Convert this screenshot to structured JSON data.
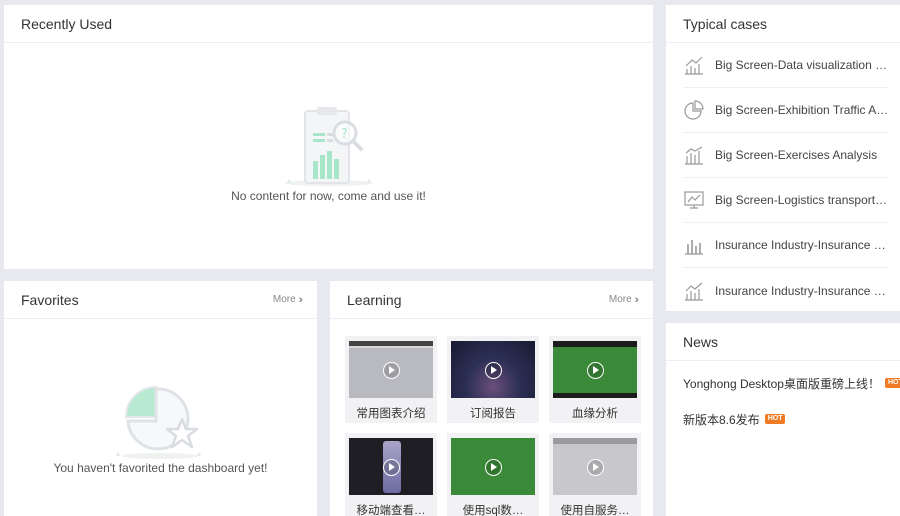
{
  "recent": {
    "title": "Recently Used",
    "empty_text": "No content for now, come and use it!"
  },
  "favorites": {
    "title": "Favorites",
    "more": "More",
    "empty_text": "You haven't favorited the dashboard yet!"
  },
  "learning": {
    "title": "Learning",
    "more": "More",
    "videos": [
      {
        "title": "常用图表介绍",
        "thumb": "gray"
      },
      {
        "title": "订阅报告",
        "thumb": "dark"
      },
      {
        "title": "血缘分析",
        "thumb": "green"
      },
      {
        "title": "移动端查看…",
        "thumb": "phone"
      },
      {
        "title": "使用sql数…",
        "thumb": "green"
      },
      {
        "title": "使用自服务…",
        "thumb": "light"
      }
    ]
  },
  "cases": {
    "title": "Typical cases",
    "items": [
      {
        "label": "Big Screen-Data visualization and analysis",
        "icon": "line-chart-icon"
      },
      {
        "label": "Big Screen-Exhibition Traffic Analysis",
        "icon": "pie-chart-icon"
      },
      {
        "label": "Big Screen-Exercises Analysis",
        "icon": "bar-line-chart-icon"
      },
      {
        "label": "Big Screen-Logistics transportation analysis",
        "icon": "monitor-chart-icon"
      },
      {
        "label": "Insurance Industry-Insurance Industry Analysis",
        "icon": "bar-chart-icon"
      },
      {
        "label": "Insurance Industry-Insurance Industry Report",
        "icon": "bar-trend-chart-icon"
      }
    ]
  },
  "news": {
    "title": "News",
    "items": [
      {
        "text": "Yonghong Desktop桌面版重磅上线！",
        "badge": "HOT"
      },
      {
        "text": "新版本8.6发布",
        "badge": "HOT"
      }
    ]
  },
  "colors": {
    "background": "#e8e9ee",
    "accent_green": "#8fd9b6",
    "hot_badge": "#f07b25"
  }
}
